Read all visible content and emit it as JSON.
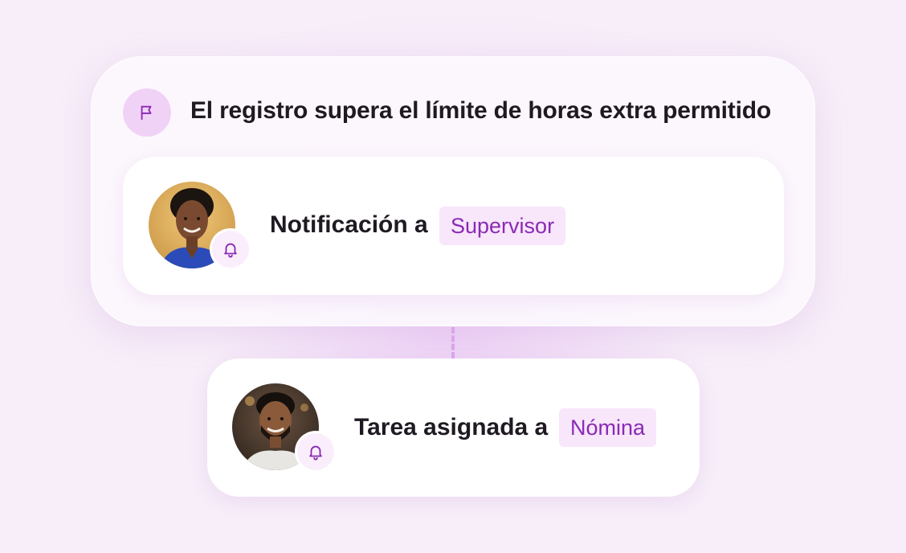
{
  "rule": {
    "title": "El registro supera el límite de horas extra permitido",
    "icon": "flag-icon"
  },
  "steps": [
    {
      "action_text": "Notificación a",
      "recipient": "Supervisor",
      "avatar": "person-avatar",
      "badge_icon": "bell-icon"
    },
    {
      "action_text": "Tarea asignada a",
      "recipient": "Nómina",
      "avatar": "person-avatar",
      "badge_icon": "bell-icon"
    }
  ],
  "colors": {
    "accent": "#8a2ab4",
    "tag_background": "#f8e6fb",
    "badge_background": "#f1d2f7",
    "connector": "#d9a6ea"
  }
}
